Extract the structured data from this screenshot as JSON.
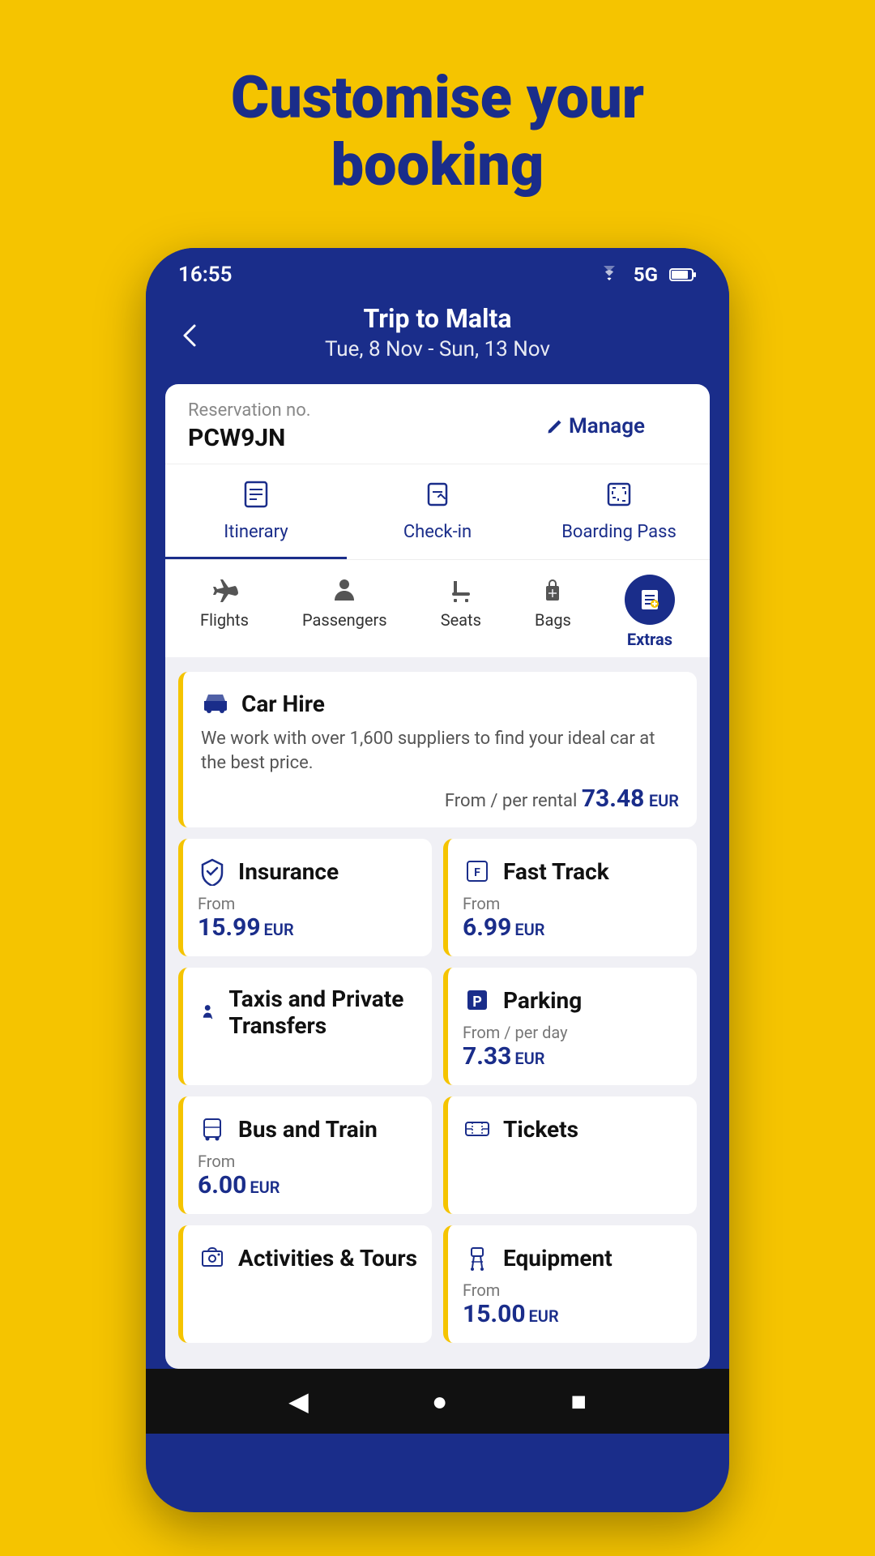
{
  "page": {
    "headline_line1": "Customise your",
    "headline_line2": "booking"
  },
  "status_bar": {
    "time": "16:55"
  },
  "header": {
    "back_label": "←",
    "trip_title": "Trip to Malta",
    "trip_dates": "Tue, 8 Nov - Sun, 13 Nov"
  },
  "reservation": {
    "label": "Reservation no.",
    "number": "PCW9JN",
    "manage_label": "Manage"
  },
  "booking_tabs": [
    {
      "id": "itinerary",
      "label": "Itinerary",
      "active": true
    },
    {
      "id": "checkin",
      "label": "Check-in",
      "active": false
    },
    {
      "id": "boarding",
      "label": "Boarding Pass",
      "active": false
    }
  ],
  "nav_items": [
    {
      "id": "flights",
      "label": "Flights",
      "active": false
    },
    {
      "id": "passengers",
      "label": "Passengers",
      "active": false
    },
    {
      "id": "seats",
      "label": "Seats",
      "active": false
    },
    {
      "id": "bags",
      "label": "Bags",
      "active": false
    },
    {
      "id": "extras",
      "label": "Extras",
      "active": true
    }
  ],
  "services": {
    "car_hire": {
      "name": "Car Hire",
      "description": "We work with over 1,600 suppliers to find your ideal car at the best price.",
      "price_prefix": "From / per rental",
      "price": "73.48",
      "currency": "EUR"
    },
    "insurance": {
      "name": "Insurance",
      "price_from": "From",
      "price": "15.99",
      "currency": "EUR"
    },
    "fast_track": {
      "name": "Fast Track",
      "price_from": "From",
      "price": "6.99",
      "currency": "EUR"
    },
    "taxis": {
      "name": "Taxis and Private Transfers"
    },
    "parking": {
      "name": "Parking",
      "price_from": "From / per day",
      "price": "7.33",
      "currency": "EUR"
    },
    "bus_train": {
      "name": "Bus and Train",
      "price_from": "From",
      "price": "6.00",
      "currency": "EUR"
    },
    "tickets": {
      "name": "Tickets"
    },
    "activities": {
      "name": "Activities & Tours"
    },
    "equipment": {
      "name": "Equipment",
      "price_from": "From",
      "price": "15.00",
      "currency": "EUR"
    }
  },
  "bottom_nav": {
    "back": "◀",
    "home": "●",
    "square": "■"
  }
}
